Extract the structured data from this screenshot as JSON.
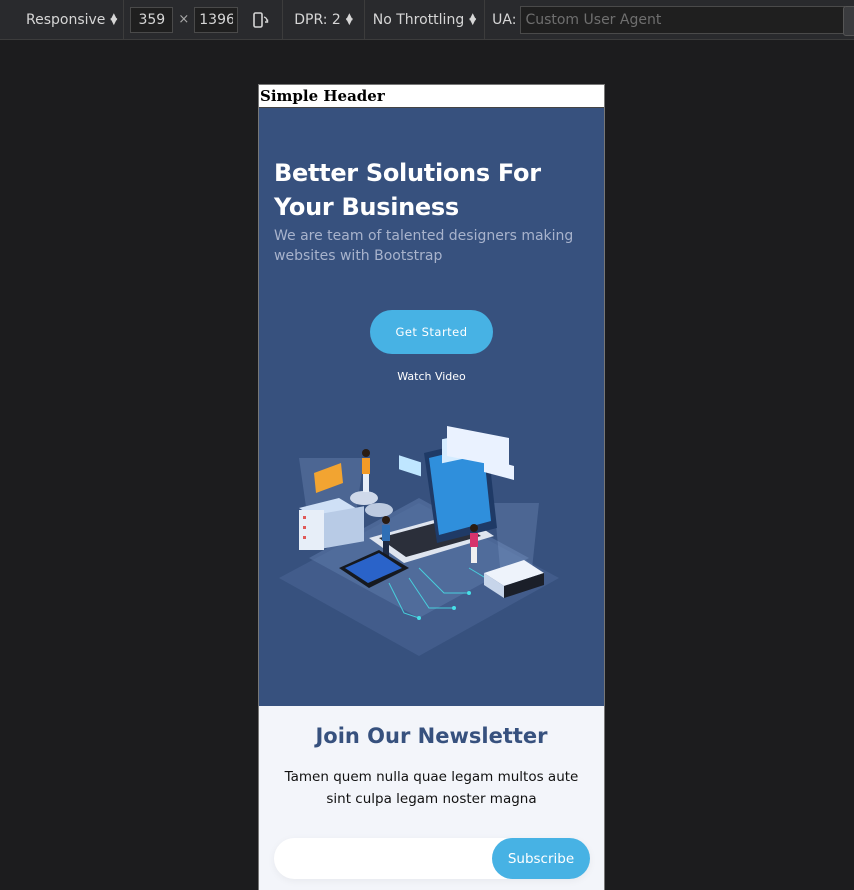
{
  "toolbar": {
    "device": "Responsive",
    "width": "359",
    "times": "×",
    "height": "1396",
    "dpr": "DPR: 2",
    "throttling": "No Throttling",
    "ua_label": "UA:",
    "ua_placeholder": "Custom User Agent"
  },
  "page": {
    "header_title": "Simple Header",
    "hero": {
      "title": "Better Solutions For Your Business",
      "subtitle": "We are team of talented designers making websites with Bootstrap",
      "cta": "Get Started",
      "video_link": "Watch Video"
    },
    "newsletter": {
      "title": "Join Our Newsletter",
      "text": "Tamen quem nulla quae legam multos aute sint culpa legam noster magna",
      "button": "Subscribe"
    }
  },
  "colors": {
    "hero_bg": "#37517e",
    "accent": "#47b2e4",
    "newsletter_bg": "#f3f5fa",
    "toolbar_bg": "#292a2d"
  }
}
